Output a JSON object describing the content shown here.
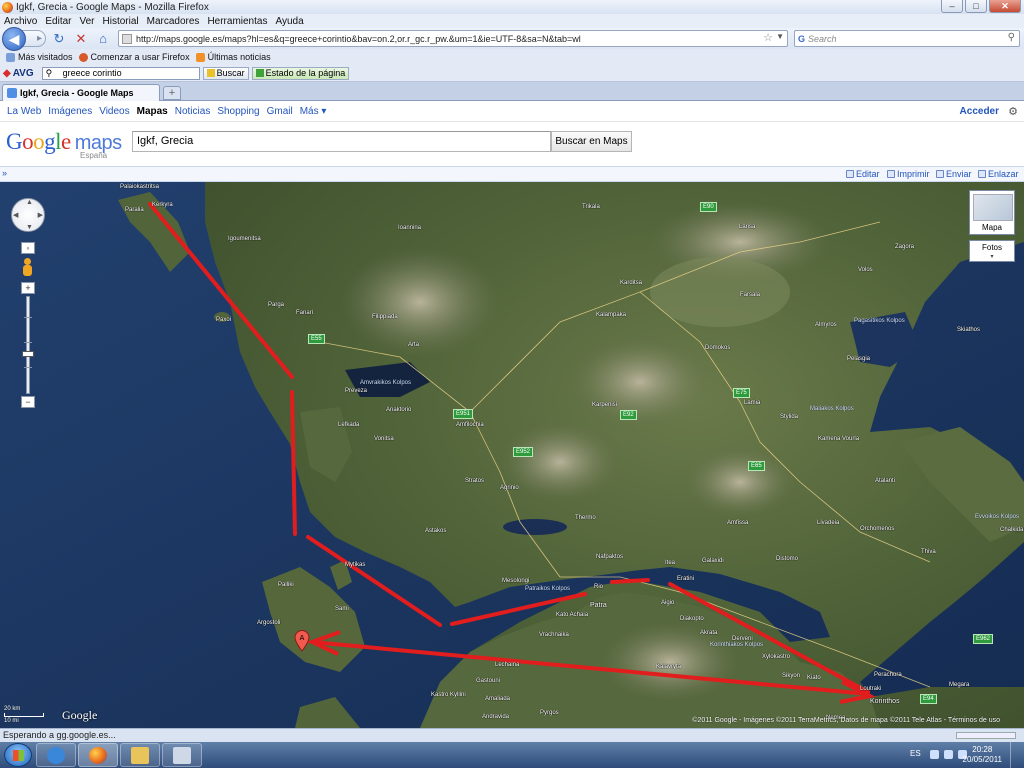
{
  "window": {
    "title": "Igkf, Grecia - Google Maps - Mozilla Firefox",
    "buttons": [
      "–",
      "□",
      "✕"
    ]
  },
  "menu": [
    "Archivo",
    "Editar",
    "Ver",
    "Historial",
    "Marcadores",
    "Herramientas",
    "Ayuda"
  ],
  "nav": {
    "back": "◀",
    "forward": "▸",
    "reload_icon": "reload-icon",
    "stop_icon": "stop-icon",
    "home_icon": "home-icon",
    "url": "http://maps.google.es/maps?hl=es&q=greece+corintio&bav=on.2,or.r_gc.r_pw.&um=1&ie=UTF-8&sa=N&tab=wl",
    "search_placeholder": "Search"
  },
  "bookmarks": [
    "Más visitados",
    "Comenzar a usar Firefox",
    "Últimas noticias"
  ],
  "avg": {
    "label": "AVG",
    "query": "greece corintio",
    "search_button": "Buscar",
    "status_button": "Estado de la página"
  },
  "tab": {
    "title": "Igkf, Grecia - Google Maps",
    "new_tab": "+"
  },
  "google_bar": {
    "links": [
      "La Web",
      "Imágenes",
      "Videos",
      "Mapas",
      "Noticias",
      "Shopping",
      "Gmail",
      "Más ▾"
    ],
    "active": "Mapas",
    "signin": "Acceder"
  },
  "maps": {
    "logo_sub": "España",
    "logo_word": "maps",
    "query": "Igkf, Grecia",
    "search_button": "Buscar en Maps",
    "toolbar": {
      "collapse": "»",
      "edit": "Editar",
      "print": "Imprimir",
      "send": "Enviar",
      "link": "Enlazar"
    },
    "map_type": "Mapa",
    "photos": "Fotos",
    "photos_dropdown": "▾",
    "scale_km": "20 km",
    "scale_mi": "10 mi",
    "copyright": "©2011 Google - Imágenes ©2011 TerraMetrics, Datos de mapa ©2011 Tele Atlas - Términos de uso",
    "marker": "A"
  },
  "places": [
    {
      "name": "Palaiokastritsa",
      "big": false
    },
    {
      "name": "Kerkyra",
      "big": false
    },
    {
      "name": "Paralia",
      "big": false
    },
    {
      "name": "Igoumenitsa",
      "big": false
    },
    {
      "name": "Parga",
      "big": false
    },
    {
      "name": "Preveza",
      "big": false
    },
    {
      "name": "Lefkada",
      "big": false
    },
    {
      "name": "Anaktorio",
      "big": false
    },
    {
      "name": "Amfilochia",
      "big": false
    },
    {
      "name": "Agrinio",
      "big": false
    },
    {
      "name": "Mesolongi",
      "big": false
    },
    {
      "name": "Patra",
      "big": true
    },
    {
      "name": "Aigio",
      "big": false
    },
    {
      "name": "Rio",
      "big": false
    },
    {
      "name": "Nafpaktos",
      "big": false
    },
    {
      "name": "Argostoli",
      "big": false
    },
    {
      "name": "Palliki",
      "big": false
    },
    {
      "name": "Sami",
      "big": false
    },
    {
      "name": "Ioannina",
      "big": false
    },
    {
      "name": "Arta",
      "big": false
    },
    {
      "name": "Karpenisi",
      "big": false
    },
    {
      "name": "Lamia",
      "big": false
    },
    {
      "name": "Larisa",
      "big": false
    },
    {
      "name": "Volos",
      "big": false
    },
    {
      "name": "Trikala",
      "big": false
    },
    {
      "name": "Karditsa",
      "big": false
    },
    {
      "name": "Domokos",
      "big": false
    },
    {
      "name": "Amfissa",
      "big": false
    },
    {
      "name": "Livadeia",
      "big": false
    },
    {
      "name": "Thiva",
      "big": false
    },
    {
      "name": "Chalkida",
      "big": false
    },
    {
      "name": "Korinthos",
      "big": false
    },
    {
      "name": "Kiato",
      "big": false
    },
    {
      "name": "Xylokastro",
      "big": false
    },
    {
      "name": "Megara",
      "big": false
    },
    {
      "name": "Kalavryta",
      "big": false
    },
    {
      "name": "Itea",
      "big": false
    },
    {
      "name": "Amaliada",
      "big": false
    },
    {
      "name": "Pyrgos",
      "big": false
    },
    {
      "name": "Kastro Kyllini",
      "big": false
    },
    {
      "name": "Vrachnaika",
      "big": false
    },
    {
      "name": "Andravida",
      "big": false
    },
    {
      "name": "Stylida",
      "big": false
    },
    {
      "name": "Atalanti",
      "big": false
    },
    {
      "name": "Sikyon",
      "big": false
    },
    {
      "name": "Zagora",
      "big": false
    },
    {
      "name": "Skiathos",
      "big": false
    },
    {
      "name": "Astakos",
      "big": false
    },
    {
      "name": "Thermo",
      "big": false
    },
    {
      "name": "Stratos",
      "big": false
    },
    {
      "name": "Mytikas",
      "big": false
    },
    {
      "name": "Paxoi",
      "big": false
    },
    {
      "name": "Fanari",
      "big": false
    },
    {
      "name": "Filippiada",
      "big": false
    },
    {
      "name": "Vonitsa",
      "big": false
    },
    {
      "name": "Kalampaka",
      "big": false
    },
    {
      "name": "Farsala",
      "big": false
    },
    {
      "name": "Almyros",
      "big": false
    },
    {
      "name": "Pelasgia",
      "big": false
    },
    {
      "name": "Kamena Vourla",
      "big": false
    },
    {
      "name": "Orchomenos",
      "big": false
    },
    {
      "name": "Distomo",
      "big": false
    },
    {
      "name": "Galaxidi",
      "big": false
    },
    {
      "name": "Eratini",
      "big": false
    },
    {
      "name": "Loutraki",
      "big": false
    },
    {
      "name": "Perachora",
      "big": false
    },
    {
      "name": "Nemea",
      "big": false
    },
    {
      "name": "Derveni",
      "big": false
    },
    {
      "name": "Akrata",
      "big": false
    },
    {
      "name": "Diakopto",
      "big": false
    },
    {
      "name": "Kato Achaia",
      "big": false
    },
    {
      "name": "Lechaina",
      "big": false
    },
    {
      "name": "Gastouni",
      "big": false
    }
  ],
  "gulfs": [
    "Pagasitikos Kolpos",
    "Amvrakikos Kolpos",
    "Korinthiakos Kolpos",
    "Patraikos Kolpos",
    "Maliakos Kolpos",
    "Evvoikos Kolpos"
  ],
  "highways": [
    "E90",
    "E92",
    "E951",
    "E55",
    "E65",
    "E75",
    "E952",
    "E962",
    "E94"
  ],
  "status": {
    "text": "Esperando a gg.google.es..."
  },
  "taskbar": {
    "lang": "ES",
    "time": "20:28",
    "date": "20/05/2011"
  }
}
